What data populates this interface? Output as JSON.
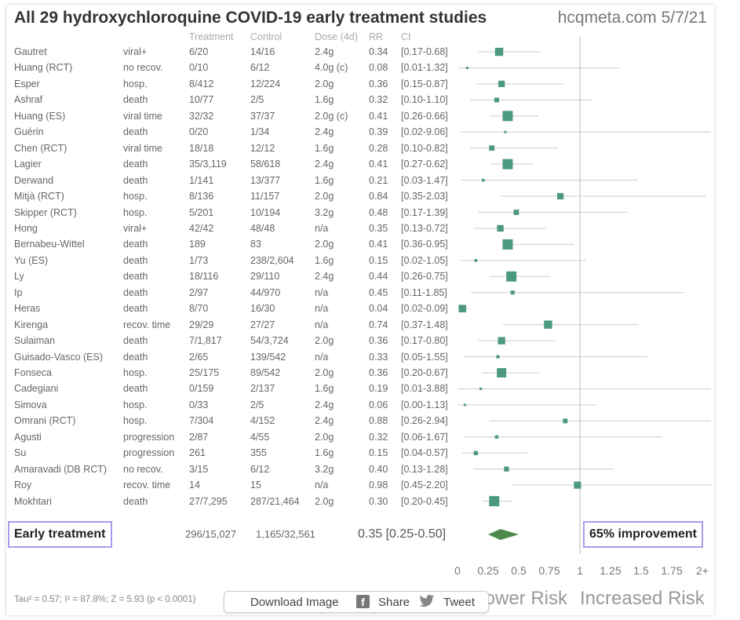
{
  "header": {
    "title": "All 29 hydroxychloroquine COVID-19 early treatment studies",
    "site": "hcqmeta.com 5/7/21"
  },
  "columns": {
    "treatment": "Treatment",
    "control": "Control",
    "dose": "Dose (4d)",
    "rr": "RR",
    "ci": "CI"
  },
  "summary": {
    "label": "Early treatment",
    "treatment": "296/15,027",
    "control": "1,165/32,561",
    "rr_ci": "0.35 [0.25-0.50]",
    "improvement": "65% improvement"
  },
  "footer": {
    "stats": "Tau² = 0.57; I² = 87.8%; Z = 5.93 (p < 0.0001)",
    "download": "Download Image",
    "share_icon": "f",
    "share": "Share",
    "tweet": "Tweet"
  },
  "chart_data": {
    "type": "forest",
    "xlim": [
      0,
      2
    ],
    "x_ticks": [
      "0",
      "0.25",
      "0.5",
      "0.75",
      "1",
      "1.25",
      "1.5",
      "1.75",
      "2+"
    ],
    "lower_label": "Lower Risk",
    "higher_label": "Increased Risk",
    "colors": {
      "marker": "#4c9a7d",
      "diamond": "#4e8a4c",
      "line": "#cccccc",
      "box_border": "#a99cf0"
    },
    "pooled": {
      "rr": 0.35,
      "lo": 0.25,
      "hi": 0.5
    },
    "studies": [
      {
        "study": "Gautret",
        "outcome": "viral+",
        "treatment": "6/20",
        "control": "14/16",
        "dose": "2.4g",
        "rr": 0.34,
        "lo": 0.17,
        "hi": 0.68,
        "rr_text": "0.34",
        "ci_text": "[0.17-0.68]"
      },
      {
        "study": "Huang (RCT)",
        "outcome": "no recov.",
        "treatment": "0/10",
        "control": "6/12",
        "dose": "4.0g (c)",
        "rr": 0.08,
        "lo": 0.01,
        "hi": 1.32,
        "rr_text": "0.08",
        "ci_text": "[0.01-1.32]"
      },
      {
        "study": "Esper",
        "outcome": "hosp.",
        "treatment": "8/412",
        "control": "12/224",
        "dose": "2.0g",
        "rr": 0.36,
        "lo": 0.15,
        "hi": 0.87,
        "rr_text": "0.36",
        "ci_text": "[0.15-0.87]"
      },
      {
        "study": "Ashraf",
        "outcome": "death",
        "treatment": "10/77",
        "control": "2/5",
        "dose": "1.6g",
        "rr": 0.32,
        "lo": 0.1,
        "hi": 1.1,
        "rr_text": "0.32",
        "ci_text": "[0.10-1.10]"
      },
      {
        "study": "Huang (ES)",
        "outcome": "viral time",
        "treatment": "32/32",
        "control": "37/37",
        "dose": "2.0g (c)",
        "rr": 0.41,
        "lo": 0.26,
        "hi": 0.66,
        "rr_text": "0.41",
        "ci_text": "[0.26-0.66]"
      },
      {
        "study": "Guérin",
        "outcome": "death",
        "treatment": "0/20",
        "control": "1/34",
        "dose": "2.4g",
        "rr": 0.39,
        "lo": 0.02,
        "hi": 9.06,
        "rr_text": "0.39",
        "ci_text": "[0.02-9.06]"
      },
      {
        "study": "Chen (RCT)",
        "outcome": "viral time",
        "treatment": "18/18",
        "control": "12/12",
        "dose": "1.6g",
        "rr": 0.28,
        "lo": 0.1,
        "hi": 0.82,
        "rr_text": "0.28",
        "ci_text": "[0.10-0.82]"
      },
      {
        "study": "Lagier",
        "outcome": "death",
        "treatment": "35/3,119",
        "control": "58/618",
        "dose": "2.4g",
        "rr": 0.41,
        "lo": 0.27,
        "hi": 0.62,
        "rr_text": "0.41",
        "ci_text": "[0.27-0.62]"
      },
      {
        "study": "Derwand",
        "outcome": "death",
        "treatment": "1/141",
        "control": "13/377",
        "dose": "1.6g",
        "rr": 0.21,
        "lo": 0.03,
        "hi": 1.47,
        "rr_text": "0.21",
        "ci_text": "[0.03-1.47]"
      },
      {
        "study": "Mitjà (RCT)",
        "outcome": "hosp.",
        "treatment": "8/136",
        "control": "11/157",
        "dose": "2.0g",
        "rr": 0.84,
        "lo": 0.35,
        "hi": 2.03,
        "rr_text": "0.84",
        "ci_text": "[0.35-2.03]"
      },
      {
        "study": "Skipper (RCT)",
        "outcome": "hosp.",
        "treatment": "5/201",
        "control": "10/194",
        "dose": "3.2g",
        "rr": 0.48,
        "lo": 0.17,
        "hi": 1.39,
        "rr_text": "0.48",
        "ci_text": "[0.17-1.39]"
      },
      {
        "study": "Hong",
        "outcome": "viral+",
        "treatment": "42/42",
        "control": "48/48",
        "dose": "n/a",
        "rr": 0.35,
        "lo": 0.13,
        "hi": 0.72,
        "rr_text": "0.35",
        "ci_text": "[0.13-0.72]"
      },
      {
        "study": "Bernabeu-Wittel",
        "outcome": "death",
        "treatment": "189",
        "control": "83",
        "dose": "2.0g",
        "rr": 0.41,
        "lo": 0.36,
        "hi": 0.95,
        "rr_text": "0.41",
        "ci_text": "[0.36-0.95]"
      },
      {
        "study": "Yu (ES)",
        "outcome": "death",
        "treatment": "1/73",
        "control": "238/2,604",
        "dose": "1.6g",
        "rr": 0.15,
        "lo": 0.02,
        "hi": 1.05,
        "rr_text": "0.15",
        "ci_text": "[0.02-1.05]"
      },
      {
        "study": "Ly",
        "outcome": "death",
        "treatment": "18/116",
        "control": "29/110",
        "dose": "2.4g",
        "rr": 0.44,
        "lo": 0.26,
        "hi": 0.75,
        "rr_text": "0.44",
        "ci_text": "[0.26-0.75]"
      },
      {
        "study": "Ip",
        "outcome": "death",
        "treatment": "2/97",
        "control": "44/970",
        "dose": "n/a",
        "rr": 0.45,
        "lo": 0.11,
        "hi": 1.85,
        "rr_text": "0.45",
        "ci_text": "[0.11-1.85]"
      },
      {
        "study": "Heras",
        "outcome": "death",
        "treatment": "8/70",
        "control": "16/30",
        "dose": "n/a",
        "rr": 0.04,
        "lo": 0.02,
        "hi": 0.09,
        "rr_text": "0.04",
        "ci_text": "[0.02-0.09]"
      },
      {
        "study": "Kirenga",
        "outcome": "recov. time",
        "treatment": "29/29",
        "control": "27/27",
        "dose": "n/a",
        "rr": 0.74,
        "lo": 0.37,
        "hi": 1.48,
        "rr_text": "0.74",
        "ci_text": "[0.37-1.48]"
      },
      {
        "study": "Sulaiman",
        "outcome": "death",
        "treatment": "7/1,817",
        "control": "54/3,724",
        "dose": "2.0g",
        "rr": 0.36,
        "lo": 0.17,
        "hi": 0.8,
        "rr_text": "0.36",
        "ci_text": "[0.17-0.80]"
      },
      {
        "study": "Guisado-Vasco (ES)",
        "outcome": "death",
        "treatment": "2/65",
        "control": "139/542",
        "dose": "n/a",
        "rr": 0.33,
        "lo": 0.05,
        "hi": 1.55,
        "rr_text": "0.33",
        "ci_text": "[0.05-1.55]"
      },
      {
        "study": "Fonseca",
        "outcome": "hosp.",
        "treatment": "25/175",
        "control": "89/542",
        "dose": "2.0g",
        "rr": 0.36,
        "lo": 0.2,
        "hi": 0.67,
        "rr_text": "0.36",
        "ci_text": "[0.20-0.67]"
      },
      {
        "study": "Cadegiani",
        "outcome": "death",
        "treatment": "0/159",
        "control": "2/137",
        "dose": "1.6g",
        "rr": 0.19,
        "lo": 0.01,
        "hi": 3.88,
        "rr_text": "0.19",
        "ci_text": "[0.01-3.88]"
      },
      {
        "study": "Simova",
        "outcome": "hosp.",
        "treatment": "0/33",
        "control": "2/5",
        "dose": "2.4g",
        "rr": 0.06,
        "lo": 0.0,
        "hi": 1.13,
        "rr_text": "0.06",
        "ci_text": "[0.00-1.13]"
      },
      {
        "study": "Omrani (RCT)",
        "outcome": "hosp.",
        "treatment": "7/304",
        "control": "4/152",
        "dose": "2.4g",
        "rr": 0.88,
        "lo": 0.26,
        "hi": 2.94,
        "rr_text": "0.88",
        "ci_text": "[0.26-2.94]"
      },
      {
        "study": "Agusti",
        "outcome": "progression",
        "treatment": "2/87",
        "control": "4/55",
        "dose": "2.0g",
        "rr": 0.32,
        "lo": 0.06,
        "hi": 1.67,
        "rr_text": "0.32",
        "ci_text": "[0.06-1.67]"
      },
      {
        "study": "Su",
        "outcome": "progression",
        "treatment": "261",
        "control": "355",
        "dose": "1.6g",
        "rr": 0.15,
        "lo": 0.04,
        "hi": 0.57,
        "rr_text": "0.15",
        "ci_text": "[0.04-0.57]"
      },
      {
        "study": "Amaravadi (DB RCT)",
        "outcome": "no recov.",
        "treatment": "3/15",
        "control": "6/12",
        "dose": "3.2g",
        "rr": 0.4,
        "lo": 0.13,
        "hi": 1.28,
        "rr_text": "0.40",
        "ci_text": "[0.13-1.28]"
      },
      {
        "study": "Roy",
        "outcome": "recov. time",
        "treatment": "14",
        "control": "15",
        "dose": "n/a",
        "rr": 0.98,
        "lo": 0.45,
        "hi": 2.2,
        "rr_text": "0.98",
        "ci_text": "[0.45-2.20]"
      },
      {
        "study": "Mokhtari",
        "outcome": "death",
        "treatment": "27/7,295",
        "control": "287/21,464",
        "dose": "2.0g",
        "rr": 0.3,
        "lo": 0.2,
        "hi": 0.45,
        "rr_text": "0.30",
        "ci_text": "[0.20-0.45]"
      }
    ]
  }
}
